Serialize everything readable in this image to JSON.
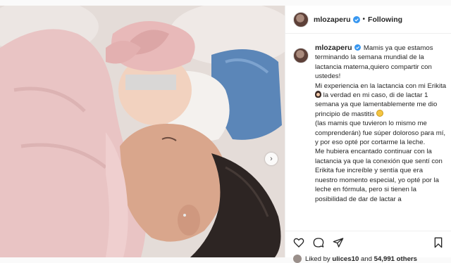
{
  "post": {
    "username": "mlozaperu",
    "follow_state": "Following",
    "separator": "•"
  },
  "caption": {
    "username": "mlozaperu",
    "lines": [
      "Mamis ya que estamos terminando la semana mundial de la lactancia materna,quiero compartir con ustedes!",
      "Mi experiencia en la lactancia con mi Erikita",
      "la verdad en mi caso, di de lactar 1 semana ya que lamentablemente me dio principio de mastitis",
      "(las mamis que tuvieron lo mismo me comprenderán) fue súper doloroso para mí, y por eso opté por cortarme la leche.",
      "Me hubiera encantado continuar con la lactancia ya que la conexión que sentí con Erikita fue increíble y sentía que era nuestro momento especial, yo opté por la leche en fórmula, pero si tienen la posibilidad de dar de lactar a"
    ]
  },
  "likes": {
    "prefix": "Liked by",
    "user": "ulices10",
    "joiner": "and",
    "others": "54,991 others"
  },
  "colors": {
    "verified_blue": "#3897f0",
    "text": "#262626",
    "border": "#efefef"
  },
  "icons": [
    "heart-icon",
    "comment-icon",
    "share-icon",
    "bookmark-icon",
    "verified-badge-icon",
    "next-arrow-icon"
  ]
}
